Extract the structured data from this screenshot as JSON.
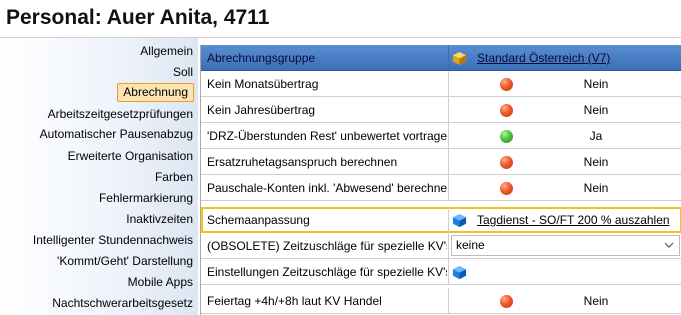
{
  "header": {
    "title": "Personal: Auer Anita, 4711"
  },
  "sidebar": {
    "items": [
      {
        "label": "Allgemein",
        "active": false
      },
      {
        "label": "Soll",
        "active": false
      },
      {
        "label": "Abrechnung",
        "active": true
      },
      {
        "label": "Arbeitszeitgesetzprüfungen",
        "active": false
      },
      {
        "label": "Automatischer Pausenabzug",
        "active": false
      },
      {
        "label": "Erweiterte Organisation",
        "active": false
      },
      {
        "label": "Farben",
        "active": false
      },
      {
        "label": "Fehlermarkierung",
        "active": false
      },
      {
        "label": "Inaktivzeiten",
        "active": false
      },
      {
        "label": "Intelligenter Stundennachweis",
        "active": false
      },
      {
        "label": "'Kommt/Geht' Darstellung",
        "active": false
      },
      {
        "label": "Mobile Apps",
        "active": false
      },
      {
        "label": "Nachtschwerarbeitsgesetz",
        "active": false
      }
    ]
  },
  "grid": {
    "header": {
      "label": "Abrechnungsgruppe",
      "link": "Standard Österreich (V7)",
      "icon": "gold-cube-icon"
    },
    "rows": [
      {
        "label": "Kein Monatsübertrag",
        "status": "red",
        "value": "Nein"
      },
      {
        "label": "Kein Jahresübertrag",
        "status": "red",
        "value": "Nein"
      },
      {
        "label": "'DRZ-Überstunden Rest' unbewertet vortragen",
        "status": "green",
        "value": "Ja"
      },
      {
        "label": "Ersatzruhetagsanspruch berechnen",
        "status": "red",
        "value": "Nein"
      },
      {
        "label": "Pauschale-Konten inkl. 'Abwesend' berechnen",
        "status": "red",
        "value": "Nein"
      }
    ],
    "schema": {
      "label": "Schemaanpassung",
      "link": "Tagdienst - SO/FT 200 % auszahlen",
      "icon": "blue-cube-icon",
      "highlight": "#f2c218"
    },
    "obsolete": {
      "label": "(OBSOLETE) Zeitzuschläge für spezielle KV's",
      "dropdown_value": "keine"
    },
    "einstellungen": {
      "label": "Einstellungen Zeitzuschläge für spezielle KV's",
      "icon": "blue-cube-icon"
    },
    "feiertag": {
      "label": "Feiertag +4h/+8h laut KV Handel",
      "status": "red",
      "value": "Nein"
    }
  },
  "colors": {
    "header_row": "#4a7fc4",
    "active_tab": "#fbe3b4",
    "highlight_border": "#f2c218"
  }
}
